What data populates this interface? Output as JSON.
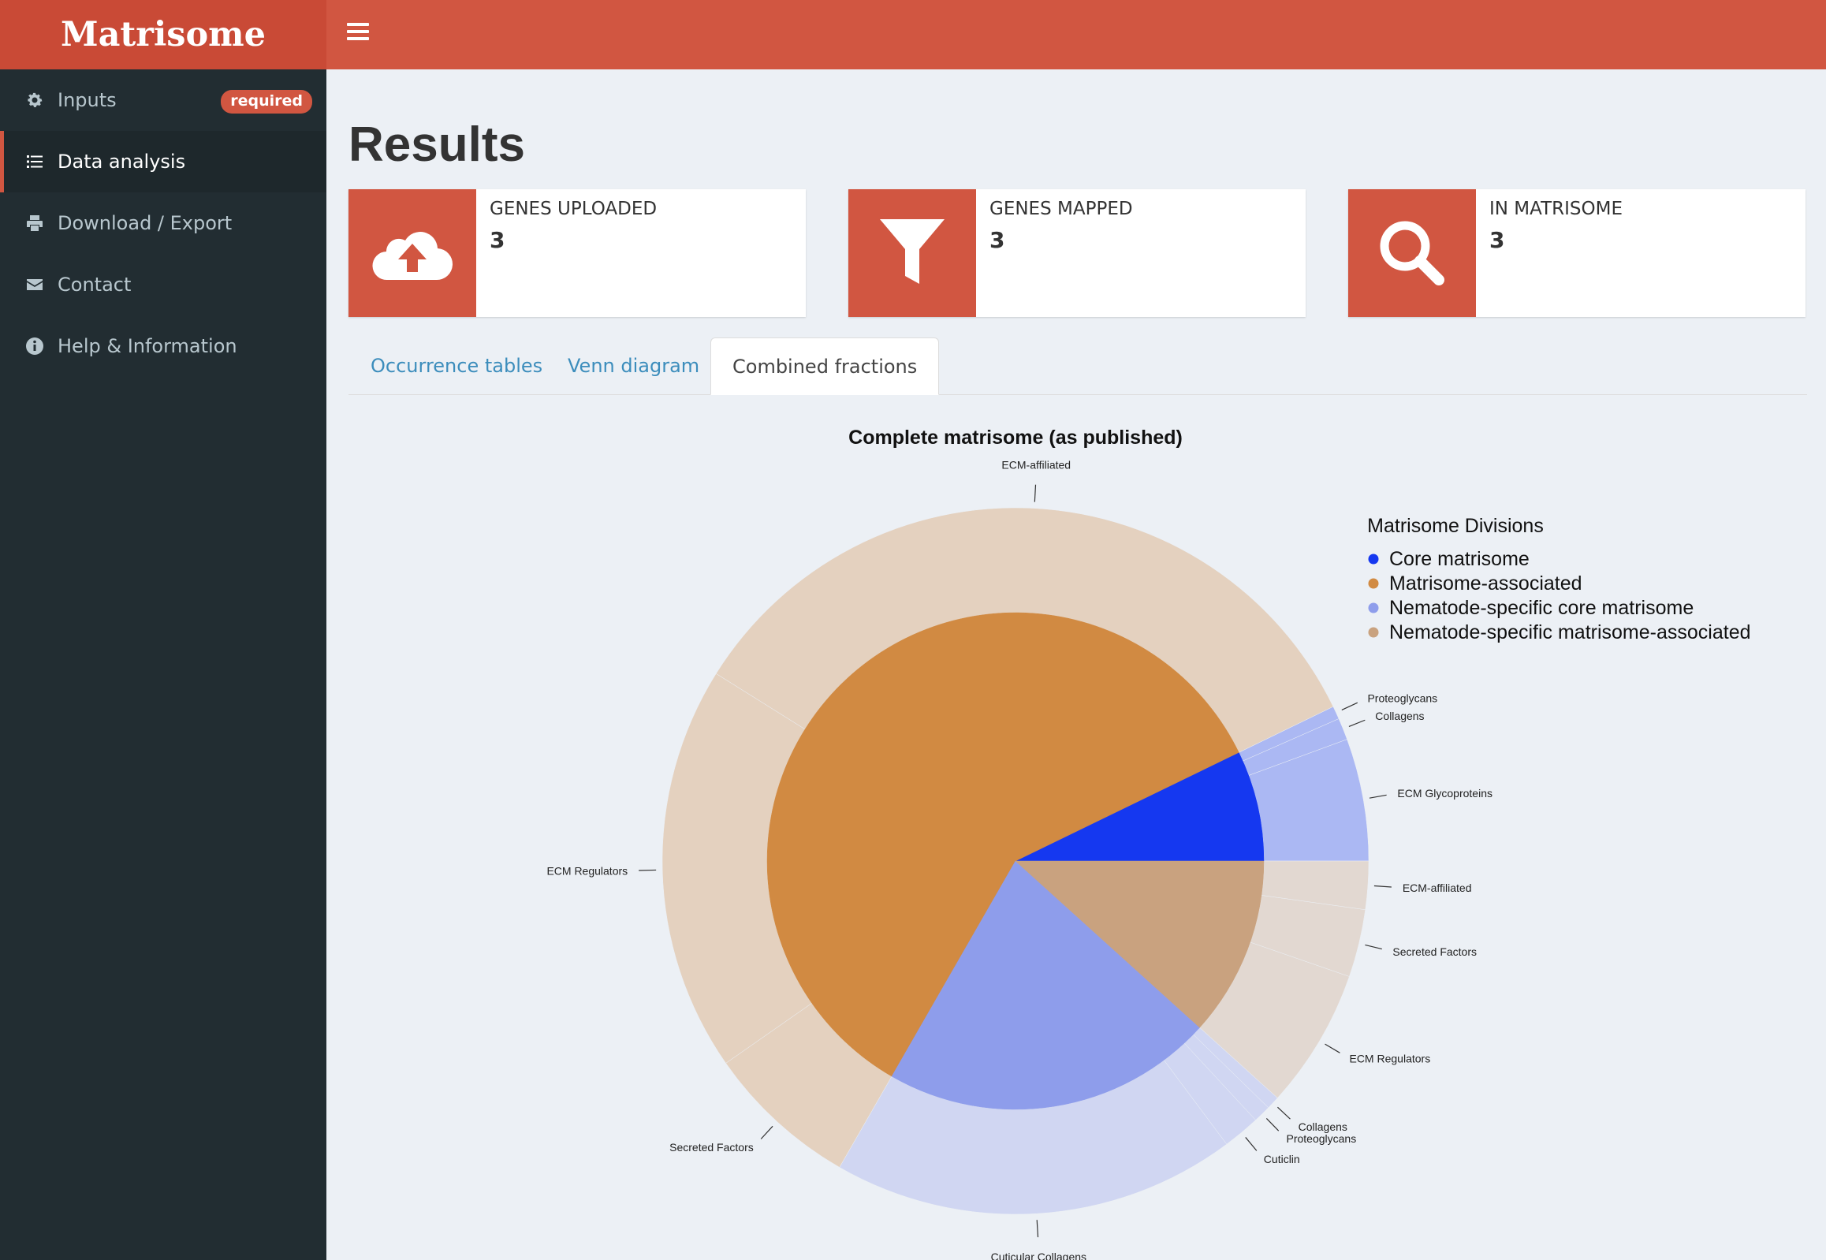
{
  "app": {
    "title": "Matrisome"
  },
  "sidebar": {
    "items": [
      {
        "label": "Inputs",
        "icon": "gear-icon",
        "badge": "required"
      },
      {
        "label": "Data analysis",
        "icon": "list-icon",
        "active": true
      },
      {
        "label": "Download / Export",
        "icon": "printer-icon"
      },
      {
        "label": "Contact",
        "icon": "envelope-icon"
      },
      {
        "label": "Help & Information",
        "icon": "info-icon"
      }
    ]
  },
  "main": {
    "title": "Results",
    "info_boxes": [
      {
        "label": "GENES UPLOADED",
        "value": "3",
        "icon": "cloud-upload-icon"
      },
      {
        "label": "GENES MAPPED",
        "value": "3",
        "icon": "filter-icon"
      },
      {
        "label": "IN MATRISOME",
        "value": "3",
        "icon": "search-icon"
      }
    ],
    "tabs": [
      {
        "label": "Occurrence tables",
        "active": false
      },
      {
        "label": "Venn diagram",
        "active": false
      },
      {
        "label": "Combined fractions",
        "active": true
      }
    ]
  },
  "colors": {
    "accent": "#d15641",
    "logo_bg": "#c94a36",
    "sidebar_bg": "#222d32",
    "core": "#1538f0",
    "associated": "#d18a42",
    "nematode_core": "#8e9deb",
    "nematode_associated": "#c9a27f"
  },
  "chart_data": {
    "type": "pie",
    "subtype": "nested-donut",
    "title": "Complete matrisome (as published)",
    "legend": {
      "title": "Matrisome Divisions",
      "placement": "top-right",
      "entries": [
        {
          "name": "Core matrisome",
          "color": "#1538f0"
        },
        {
          "name": "Matrisome-associated",
          "color": "#d18a42"
        },
        {
          "name": "Nematode-specific core matrisome",
          "color": "#8e9deb"
        },
        {
          "name": "Nematode-specific matrisome-associated",
          "color": "#c9a27f"
        }
      ]
    },
    "inner_ring": [
      {
        "division": "Core matrisome",
        "value": 7.2,
        "color": "#1538f0"
      },
      {
        "division": "Matrisome-associated",
        "value": 59.5,
        "color": "#d18a42"
      },
      {
        "division": "Nematode-specific core matrisome",
        "value": 21.6,
        "color": "#8e9deb"
      },
      {
        "division": "Nematode-specific matrisome-associated",
        "value": 11.7,
        "color": "#c9a27f"
      }
    ],
    "outer_ring": [
      {
        "label": "ECM Glycoproteins",
        "division": "Core matrisome",
        "value": 5.6
      },
      {
        "label": "Collagens",
        "division": "Core matrisome",
        "value": 1.0
      },
      {
        "label": "Proteoglycans",
        "division": "Core matrisome",
        "value": 0.6
      },
      {
        "label": "ECM-affiliated",
        "division": "Matrisome-associated",
        "value": 33.9
      },
      {
        "label": "ECM Regulators",
        "division": "Matrisome-associated",
        "value": 18.6
      },
      {
        "label": "Secreted Factors",
        "division": "Matrisome-associated",
        "value": 7.0
      },
      {
        "label": "Cuticular Collagens",
        "division": "Nematode-specific core matrisome",
        "value": 18.5
      },
      {
        "label": "Cuticlin",
        "division": "Nematode-specific core matrisome",
        "value": 1.7
      },
      {
        "label": "Proteoglycans",
        "division": "Nematode-specific core matrisome",
        "value": 0.8
      },
      {
        "label": "Collagens",
        "division": "Nematode-specific core matrisome",
        "value": 0.6
      },
      {
        "label": "ECM Regulators",
        "division": "Nematode-specific matrisome-associated",
        "value": 6.4
      },
      {
        "label": "Secreted Factors",
        "division": "Nematode-specific matrisome-associated",
        "value": 3.1
      },
      {
        "label": "ECM-affiliated",
        "division": "Nematode-specific matrisome-associated",
        "value": 2.2
      }
    ]
  }
}
